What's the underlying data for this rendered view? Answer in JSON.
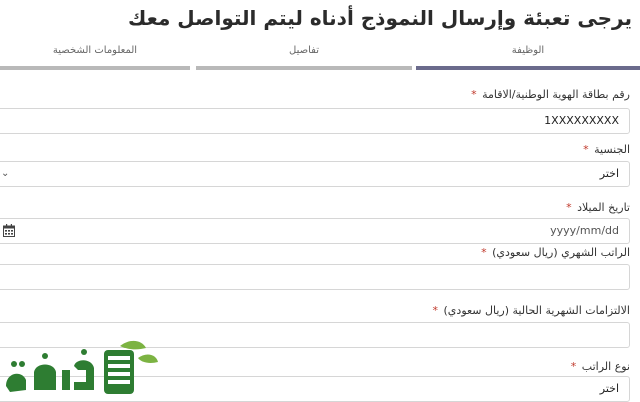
{
  "page": {
    "title": "يرجى تعبئة وإرسال النموذج أدناه ليتم التواصل معك"
  },
  "tabs": [
    {
      "label": "الوظيفة",
      "active": true
    },
    {
      "label": "تفاصيل",
      "active": false
    },
    {
      "label": "المعلومات الشخصية",
      "active": false
    }
  ],
  "form": {
    "id_number": {
      "label": "رقم بطاقة الهوية الوطنية/الاقامة",
      "required": "*",
      "value": "1XXXXXXXXX"
    },
    "nationality": {
      "label": "الجنسية",
      "required": "*",
      "value": "اختر"
    },
    "birth_date": {
      "label": "تاريخ الميلاد",
      "required": "*",
      "placeholder": "yyyy/mm/dd"
    },
    "monthly_salary": {
      "label": "الراتب الشهري (ريال سعودي)",
      "required": "*",
      "value": ""
    },
    "monthly_obligations": {
      "label": "الالتزامات الشهرية الحالية (ريال سعودي)",
      "required": "*",
      "value": ""
    },
    "salary_type": {
      "label": "نوع الراتب",
      "required": "*",
      "value": "اختر"
    }
  },
  "watermark": {
    "text": "فكرة",
    "color_primary": "#2e7d32",
    "color_accent": "#7cb342"
  }
}
